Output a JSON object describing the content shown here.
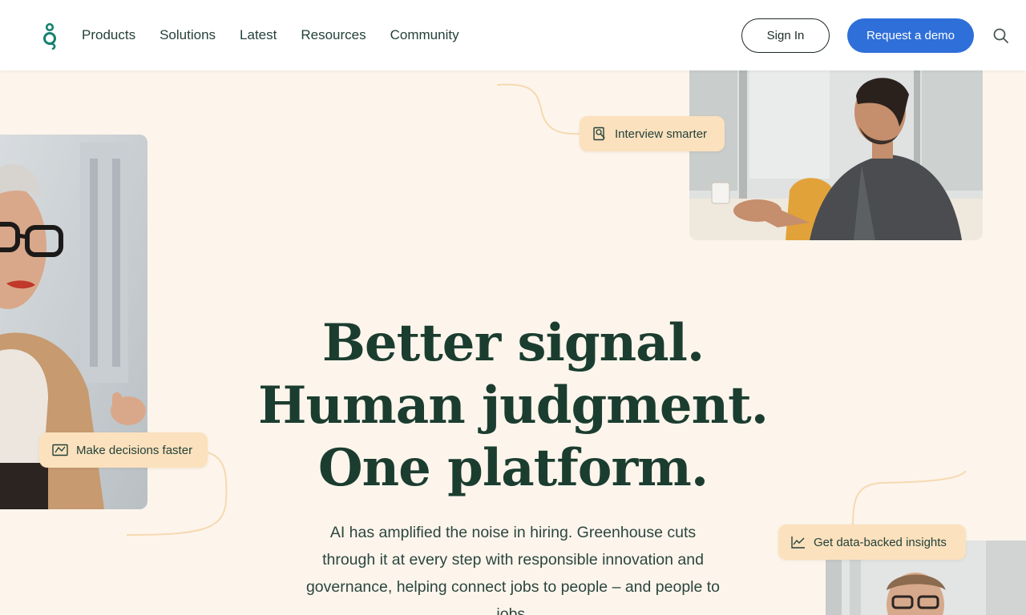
{
  "header": {
    "logo_icon": "greenhouse-g-logo",
    "nav": [
      "Products",
      "Solutions",
      "Latest",
      "Resources",
      "Community"
    ],
    "signin_label": "Sign In",
    "demo_label": "Request a demo",
    "search_icon": "search-icon"
  },
  "pills": {
    "interview": "Interview smarter",
    "decisions": "Make decisions faster",
    "insights": "Get data-backed insights"
  },
  "hero": {
    "line1": "Better signal.",
    "line2": "Human judgment.",
    "line3": "One platform.",
    "subtext": "AI has amplified the noise in hiring. Greenhouse cuts through it at every step with responsible innovation and governance, helping connect jobs to people – and people to jobs."
  },
  "colors": {
    "background": "#fdf5ec",
    "heading": "#1b3d30",
    "brand_green": "#14826e",
    "primary_button": "#2f6fd9",
    "pill": "#fbe1bd"
  }
}
